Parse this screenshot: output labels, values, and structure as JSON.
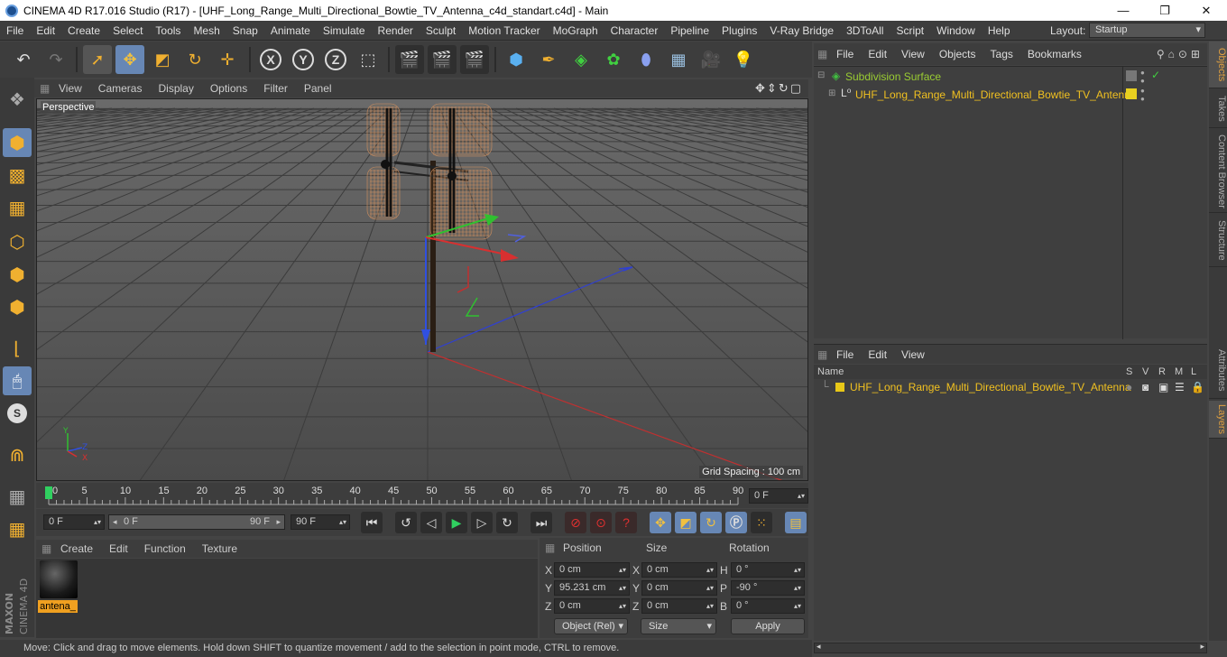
{
  "title": "CINEMA 4D R17.016 Studio (R17) - [UHF_Long_Range_Multi_Directional_Bowtie_TV_Antenna_c4d_standart.c4d] - Main",
  "menu": [
    "File",
    "Edit",
    "Create",
    "Select",
    "Tools",
    "Mesh",
    "Snap",
    "Animate",
    "Simulate",
    "Render",
    "Sculpt",
    "Motion Tracker",
    "MoGraph",
    "Character",
    "Pipeline",
    "Plugins",
    "V-Ray Bridge",
    "3DToAll",
    "Script",
    "Window",
    "Help"
  ],
  "layout": {
    "label": "Layout:",
    "value": "Startup"
  },
  "viewport": {
    "menu": [
      "View",
      "Cameras",
      "Display",
      "Options",
      "Filter",
      "Panel"
    ],
    "label": "Perspective",
    "grid_spacing": "Grid Spacing : 100 cm"
  },
  "timeline": {
    "ticks": [
      "0",
      "5",
      "10",
      "15",
      "20",
      "25",
      "30",
      "35",
      "40",
      "45",
      "50",
      "55",
      "60",
      "65",
      "70",
      "75",
      "80",
      "85",
      "90"
    ],
    "current_frame": "0 F"
  },
  "transport": {
    "start": "0 F",
    "range_start": "0 F",
    "range_end": "90 F",
    "end": "90 F"
  },
  "material_menu": [
    "Create",
    "Edit",
    "Function",
    "Texture"
  ],
  "material": {
    "name": "antena_"
  },
  "coords": {
    "headers": {
      "position": "Position",
      "size": "Size",
      "rotation": "Rotation"
    },
    "axes": [
      "X",
      "Y",
      "Z"
    ],
    "rot_axes": [
      "H",
      "P",
      "B"
    ],
    "position": [
      "0 cm",
      "95.231 cm",
      "0 cm"
    ],
    "size": [
      "0 cm",
      "0 cm",
      "0 cm"
    ],
    "rotation": [
      "0 °",
      "-90 °",
      "0 °"
    ],
    "mode": "Object (Rel)",
    "size_mode": "Size",
    "apply": "Apply"
  },
  "status": "Move: Click and drag to move elements. Hold down SHIFT to quantize movement / add to the selection in point mode, CTRL to remove.",
  "objects": {
    "menu": [
      "File",
      "Edit",
      "View",
      "Objects",
      "Tags",
      "Bookmarks"
    ],
    "items": [
      {
        "name": "Subdivision Surface",
        "color": "#9acd32"
      },
      {
        "name": "UHF_Long_Range_Multi_Directional_Bowtie_TV_Antenna",
        "color": "#f0c020"
      }
    ]
  },
  "layers": {
    "menu": [
      "File",
      "Edit",
      "View"
    ],
    "columns": {
      "name": "Name",
      "flags": [
        "S",
        "V",
        "R",
        "M",
        "L"
      ]
    },
    "items": [
      {
        "name": "UHF_Long_Range_Multi_Directional_Bowtie_TV_Antenna",
        "color": "#e8c818"
      }
    ]
  },
  "right_tabs": [
    "Objects",
    "Takes",
    "Content Browser",
    "Structure",
    "Attributes",
    "Layers"
  ],
  "colors": {
    "accent": "#6787b5",
    "highlight": "#e0a040",
    "axis_x": "#d83030",
    "axis_y": "#30c030",
    "axis_z": "#3050d8"
  }
}
